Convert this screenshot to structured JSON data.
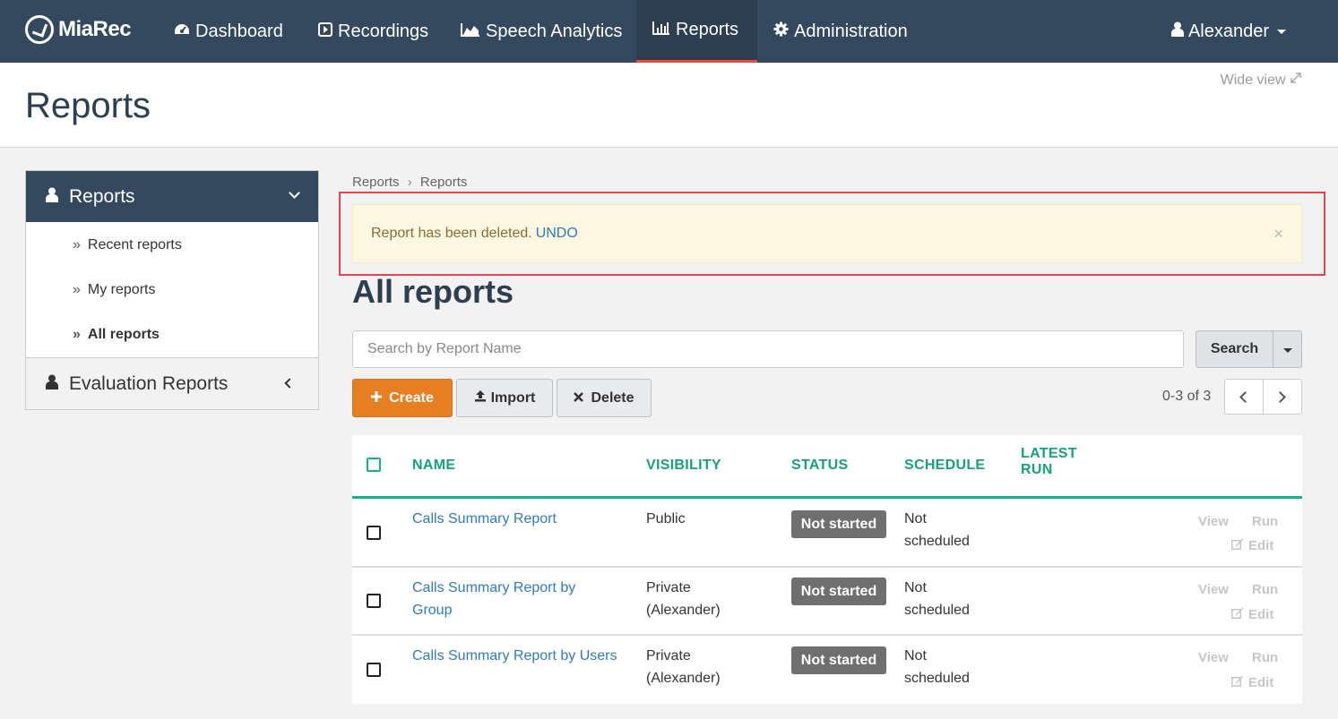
{
  "nav": {
    "brand": "MiaRec",
    "items": [
      {
        "label": "Dashboard",
        "icon": "dashboard-icon"
      },
      {
        "label": "Recordings",
        "icon": "play-icon"
      },
      {
        "label": "Speech Analytics",
        "icon": "area-chart-icon"
      },
      {
        "label": "Reports",
        "icon": "bar-chart-icon"
      },
      {
        "label": "Administration",
        "icon": "gear-icon"
      }
    ],
    "user": "Alexander"
  },
  "header": {
    "title": "Reports",
    "wide_view": "Wide view"
  },
  "sidebar": {
    "section": "Reports",
    "links": [
      "Recent reports",
      "My reports",
      "All reports"
    ],
    "subsection": "Evaluation Reports"
  },
  "breadcrumb": [
    "Reports",
    "Reports"
  ],
  "alert": {
    "message": "Report has been deleted.",
    "undo": "UNDO",
    "close": "×"
  },
  "main": {
    "title": "All reports"
  },
  "search": {
    "placeholder": "Search by Report Name",
    "button": "Search"
  },
  "toolbar": {
    "create": "Create",
    "import": "Import",
    "delete": "Delete"
  },
  "pager": {
    "text": "0-3 of 3"
  },
  "table": {
    "headers": {
      "name": "NAME",
      "visibility": "VISIBILITY",
      "status": "STATUS",
      "schedule": "SCHEDULE",
      "latest_run_1": "LATEST",
      "latest_run_2": "RUN"
    },
    "rows": [
      {
        "name_1": "Calls Summary Report",
        "name_2": "",
        "vis_1": "Public",
        "vis_2": "",
        "status": "Not started",
        "sched_1": "Not",
        "sched_2": "scheduled",
        "view": "View",
        "run": "Run",
        "edit": "Edit"
      },
      {
        "name_1": "Calls Summary Report by",
        "name_2": "Group",
        "vis_1": "Private",
        "vis_2": "(Alexander)",
        "status": "Not started",
        "sched_1": "Not",
        "sched_2": "scheduled",
        "view": "View",
        "run": "Run",
        "edit": "Edit"
      },
      {
        "name_1": "Calls Summary Report by Users",
        "name_2": "",
        "vis_1": "Private",
        "vis_2": "(Alexander)",
        "status": "Not started",
        "sched_1": "Not",
        "sched_2": "scheduled",
        "view": "View",
        "run": "Run",
        "edit": "Edit"
      }
    ]
  },
  "colors": {
    "navbar": "#34495e",
    "accent_orange": "#e67e22",
    "table_accent": "#1aaf8b",
    "link": "#337ab7",
    "alert_bg": "#fcf7e1",
    "highlight_border": "#e0444c"
  }
}
